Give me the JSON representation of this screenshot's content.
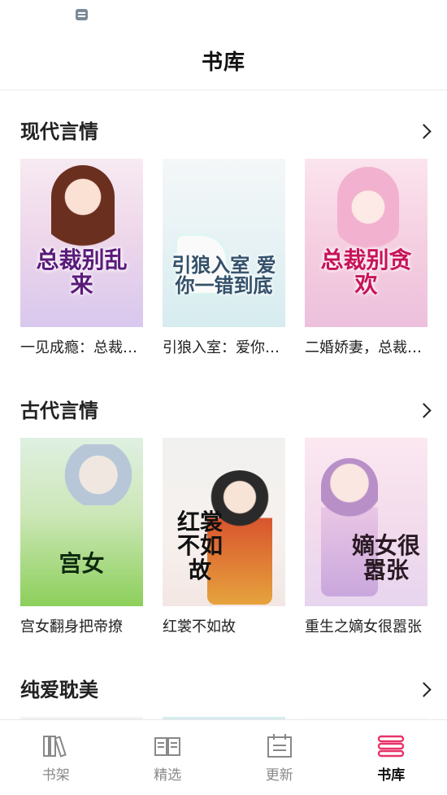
{
  "header": {
    "title": "书库"
  },
  "sections": [
    {
      "title": "现代言情",
      "books": [
        {
          "name": "一见成瘾：总裁别乱来",
          "cover_text": "总裁别乱来"
        },
        {
          "name": "引狼入室：爱你一错到底",
          "cover_text": "引狼入室 爱你一错到底"
        },
        {
          "name": "二婚娇妻，总裁别贪欢",
          "cover_text": "总裁别贪欢"
        }
      ]
    },
    {
      "title": "古代言情",
      "books": [
        {
          "name": "宫女翻身把帝撩",
          "cover_text": "宫女"
        },
        {
          "name": "红裳不如故",
          "cover_text": "红裳不如故"
        },
        {
          "name": "重生之嫡女很嚣张",
          "cover_text": "嫡女很嚣张"
        }
      ]
    },
    {
      "title": "纯爱耽美",
      "books": [
        {
          "name": ""
        },
        {
          "name": ""
        },
        {
          "name": ""
        }
      ]
    }
  ],
  "tabs": [
    {
      "label": "书架",
      "icon": "bookshelf-icon",
      "active": false
    },
    {
      "label": "精选",
      "icon": "open-book-icon",
      "active": false
    },
    {
      "label": "更新",
      "icon": "calendar-icon",
      "active": false
    },
    {
      "label": "书库",
      "icon": "library-stack-icon",
      "active": true
    }
  ],
  "colors": {
    "accent": "#e8336a",
    "tab_inactive": "#888888"
  }
}
